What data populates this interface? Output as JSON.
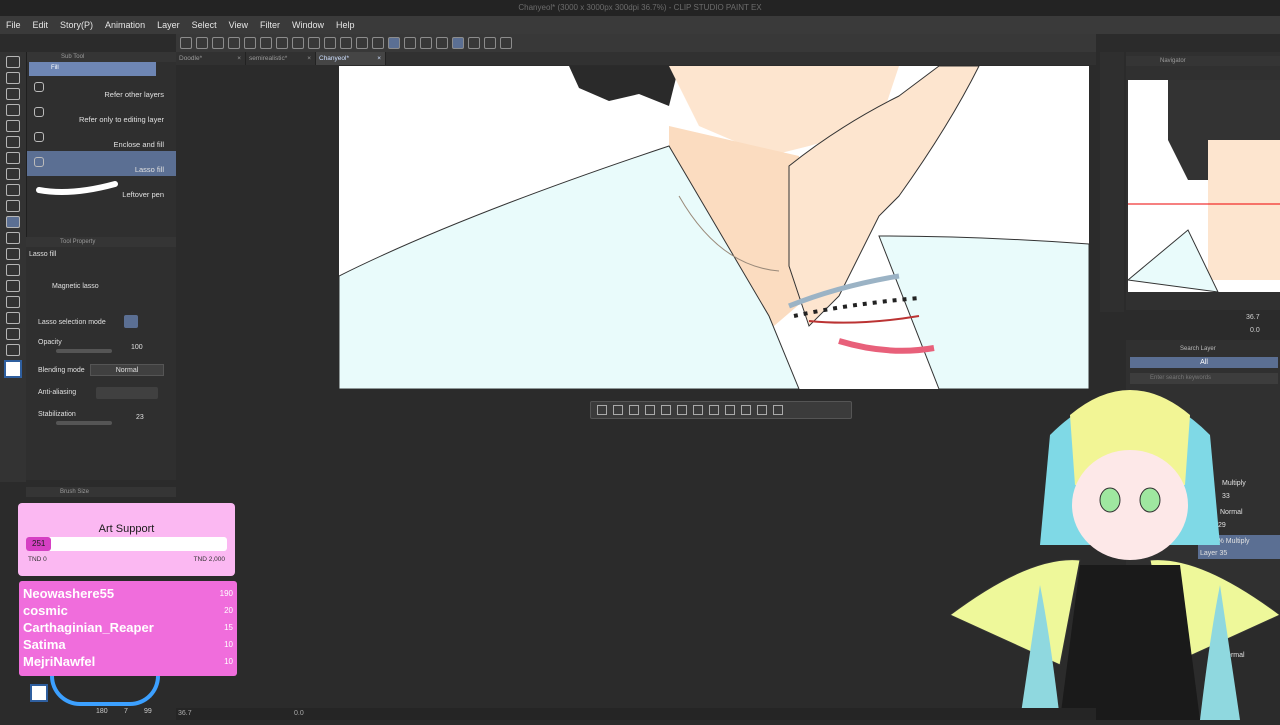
{
  "window": {
    "title": "Chanyeol* (3000 x 3000px 300dpi 36.7%) - CLIP STUDIO PAINT EX"
  },
  "menu": [
    "File",
    "Edit",
    "Story(P)",
    "Animation",
    "Layer",
    "Select",
    "View",
    "Filter",
    "Window",
    "Help"
  ],
  "tabs": [
    {
      "label": "Doodle*"
    },
    {
      "label": "semirealistic*"
    },
    {
      "label": "Chanyeol*",
      "active": true
    }
  ],
  "subtool": {
    "panel_title": "Sub Tool",
    "group": "Fill",
    "items": [
      "Refer other layers",
      "Refer only to editing layer",
      "Enclose and fill",
      "Lasso fill",
      "Leftover pen"
    ],
    "selected": "Lasso fill"
  },
  "tool_property": {
    "panel_title": "Tool Property",
    "tool_name": "Lasso fill",
    "magnetic_lasso": "Magnetic lasso",
    "selection_mode_label": "Lasso selection mode",
    "opacity_label": "Opacity",
    "opacity_value": "100",
    "blending_label": "Blending mode",
    "blending_value": "Normal",
    "antialias_label": "Anti-aliasing",
    "stabilization_label": "Stabilization",
    "stabilization_value": "23"
  },
  "brush_size": {
    "panel_title": "Brush Size"
  },
  "navigator": {
    "panel_title": "Navigator",
    "zoom": "36.7",
    "rotation": "0.0"
  },
  "layers": {
    "search_label": "Search Layer",
    "filter_all": "All",
    "search_placeholder": "Enter search keywords",
    "rows": [
      {
        "mode": "Multiply",
        "opacity": "33"
      },
      {
        "mode": "Normal",
        "opacity": "29"
      },
      {
        "mode": "100 % Multiply",
        "name": "Layer 35"
      }
    ],
    "bottom_mode": "Normal"
  },
  "art_support": {
    "title": "Art Support",
    "current": "251",
    "min_label": "TND 0",
    "max_label": "TND 2,000",
    "progress": 0.1255
  },
  "donors": [
    {
      "name": "Neowashere55",
      "amount": "190"
    },
    {
      "name": "cosmic",
      "amount": "20"
    },
    {
      "name": "Carthaginian_Reaper",
      "amount": "15"
    },
    {
      "name": "Satima",
      "amount": "10"
    },
    {
      "name": "MejriNawfel",
      "amount": "10"
    }
  ],
  "status": {
    "zoom": "36.7",
    "angle": "0.0"
  },
  "color_panel": {
    "value_a": "180",
    "value_b": "7",
    "value_c": "99"
  },
  "colors": {
    "accent": "#5b6f93",
    "canvas_bg": "#ffffff",
    "support_bg": "#fbb8f2",
    "donor_bg": "#f06ddc",
    "goal_fill": "#d540c3"
  }
}
